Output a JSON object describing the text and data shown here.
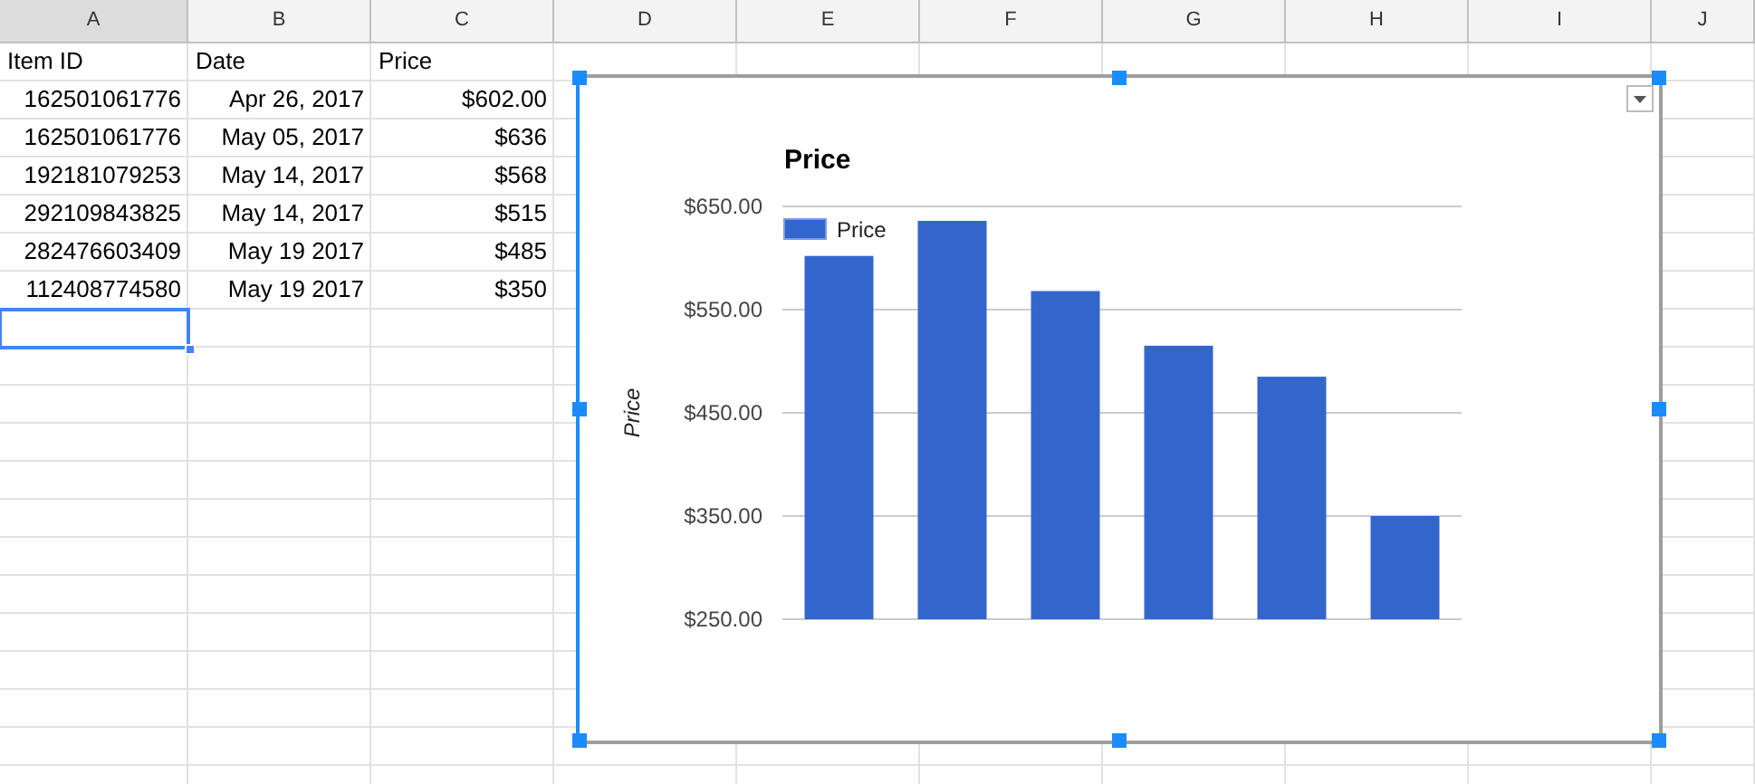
{
  "columns": [
    {
      "label": "A",
      "selected": true
    },
    {
      "label": "B",
      "selected": false
    },
    {
      "label": "C",
      "selected": false
    },
    {
      "label": "D",
      "selected": false
    },
    {
      "label": "E",
      "selected": false
    },
    {
      "label": "F",
      "selected": false
    },
    {
      "label": "G",
      "selected": false
    },
    {
      "label": "H",
      "selected": false
    },
    {
      "label": "I",
      "selected": false
    },
    {
      "label": "J",
      "selected": false
    }
  ],
  "rows": [
    {
      "cells": [
        "Item ID",
        "Date",
        "Price"
      ],
      "kind": "header",
      "selected": false
    },
    {
      "cells": [
        "162501061776",
        "Apr 26, 2017",
        "$602.00"
      ],
      "kind": "data",
      "selected": false
    },
    {
      "cells": [
        "162501061776",
        "May 05, 2017",
        "$636"
      ],
      "kind": "data",
      "selected": false
    },
    {
      "cells": [
        "192181079253",
        "May 14, 2017",
        "$568"
      ],
      "kind": "data",
      "selected": false
    },
    {
      "cells": [
        "292109843825",
        "May 14, 2017",
        "$515"
      ],
      "kind": "data",
      "selected": false
    },
    {
      "cells": [
        "282476603409",
        "May 19 2017",
        "$485"
      ],
      "kind": "data",
      "selected": false
    },
    {
      "cells": [
        "112408774580",
        "May 19 2017",
        "$350"
      ],
      "kind": "data",
      "selected": false
    },
    {
      "kind": "empty",
      "selected": true
    }
  ],
  "chart": {
    "selected": true,
    "chart_data": {
      "type": "bar",
      "grid": true,
      "title": "Price",
      "ylabel": "Price",
      "series": [
        {
          "name": "Price",
          "color": "#3366cc",
          "values": [
            602,
            636,
            568,
            515,
            485,
            350
          ]
        }
      ],
      "ylim": [
        250,
        650
      ],
      "yticks": [
        {
          "value": 250,
          "label": "$250.00"
        },
        {
          "value": 350,
          "label": "$350.00"
        },
        {
          "value": 450,
          "label": "$450.00"
        },
        {
          "value": 550,
          "label": "$550.00"
        },
        {
          "value": 650,
          "label": "$650.00"
        }
      ]
    }
  }
}
